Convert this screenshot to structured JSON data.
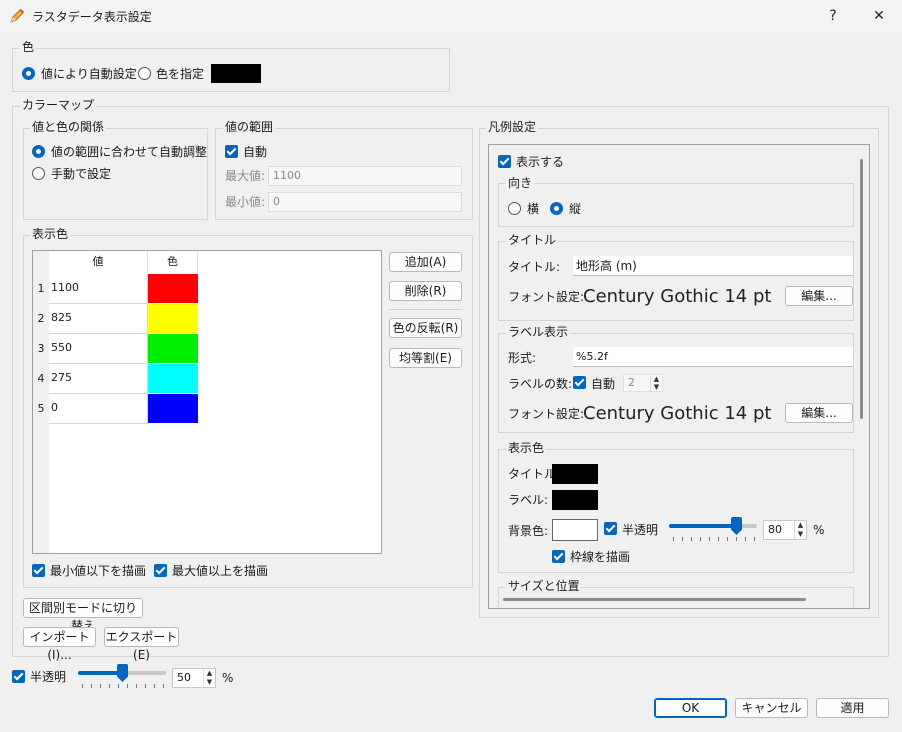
{
  "window": {
    "title": "ラスタデータ表示設定",
    "help": "?",
    "close": "✕"
  },
  "color_group": {
    "title": "色",
    "auto_label": "値により自動設定",
    "specify_label": "色を指定",
    "swatch_color": "#000000"
  },
  "colormap": {
    "title": "カラーマップ",
    "relation": {
      "title": "値と色の関係",
      "auto_adjust": "値の範囲に合わせて自動調整",
      "manual": "手動で設定"
    },
    "range": {
      "title": "値の範囲",
      "auto": "自動",
      "max_label": "最大値:",
      "max_value": "1100",
      "min_label": "最小値:",
      "min_value": "0"
    },
    "display_colors": {
      "title": "表示色",
      "col_value": "値",
      "col_color": "色",
      "rows": [
        {
          "num": "1",
          "value": "1100",
          "color": "#ff0000"
        },
        {
          "num": "2",
          "value": "825",
          "color": "#ffff00"
        },
        {
          "num": "3",
          "value": "550",
          "color": "#00ee00"
        },
        {
          "num": "4",
          "value": "275",
          "color": "#00ffff"
        },
        {
          "num": "5",
          "value": "0",
          "color": "#0000ff"
        }
      ],
      "add": "追加(A)",
      "delete": "削除(R)",
      "invert": "色の反転(R)",
      "equal_split": "均等割(E)",
      "draw_below_min": "最小値以下を描画",
      "draw_above_max": "最大値以上を描画"
    },
    "switch_mode": "区間別モードに切り替え",
    "import": "インポート(I)...",
    "export": "エクスポート(E)"
  },
  "legend": {
    "title": "凡例設定",
    "show": "表示する",
    "orientation": {
      "title": "向き",
      "horizontal": "横",
      "vertical": "縦"
    },
    "title_section": {
      "title": "タイトル",
      "title_label": "タイトル:",
      "title_value": "地形高 (m)",
      "font_label": "フォント設定:",
      "font_preview": "Century Gothic 14 pt",
      "edit": "編集..."
    },
    "label_section": {
      "title": "ラベル表示",
      "format_label": "形式:",
      "format_value": "%5.2f",
      "count_label": "ラベルの数:",
      "auto": "自動",
      "count_value": "2",
      "font_label": "フォント設定:",
      "font_preview": "Century Gothic 14 pt",
      "edit": "編集..."
    },
    "colors_section": {
      "title": "表示色",
      "title_label": "タイトル:",
      "label_label": "ラベル:",
      "bg_label": "背景色:",
      "translucent": "半透明",
      "opacity_value": "80",
      "percent": "%",
      "opacity_fraction": 0.8,
      "draw_border": "枠線を描画",
      "title_color": "#000000",
      "label_color": "#000000",
      "bg_color": "#ffffff"
    },
    "size_section": {
      "title": "サイズと位置"
    }
  },
  "bottom": {
    "translucent": "半透明",
    "opacity_value": "50",
    "percent": "%",
    "opacity_fraction": 0.5
  },
  "buttons": {
    "ok": "OK",
    "cancel": "キャンセル",
    "apply": "適用"
  },
  "accent_color": "#0067c0"
}
